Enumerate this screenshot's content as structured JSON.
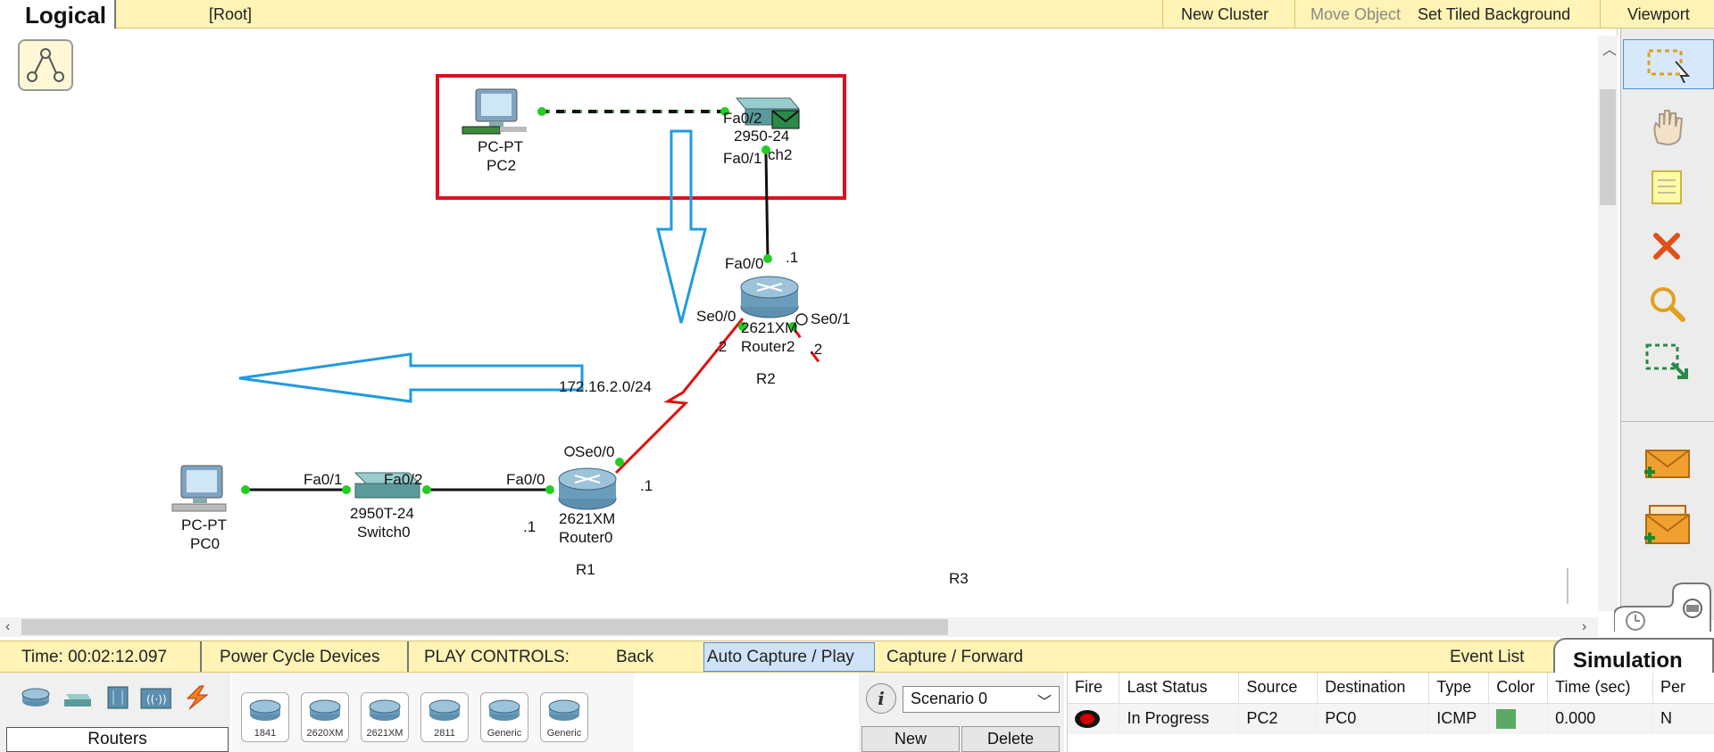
{
  "topbar": {
    "mode": "Logical",
    "path": "[Root]",
    "new_cluster": "New Cluster",
    "move_object": "Move Object",
    "set_tiled_background": "Set Tiled Background",
    "viewport": "Viewport"
  },
  "canvas": {
    "pc2": {
      "type": "PC-PT",
      "name": "PC2"
    },
    "switch2": {
      "port_top": "Fa0/2",
      "type": "2950-24",
      "name": "ch2",
      "port_bottom": "Fa0/1"
    },
    "router2": {
      "port_top": "Fa0/0",
      "addr_top": ".1",
      "port_left": "Se0/0",
      "port_right": "Se0/1",
      "type": "2621XM",
      "name": "Router2",
      "addr_left": ".2",
      "addr_right": ".2",
      "label": "R2"
    },
    "serial_net": "172.16.2.0/24",
    "router0": {
      "port_serial": "Se0/0",
      "addr_serial": ".1",
      "port_fa": "Fa0/0",
      "addr_fa": ".1",
      "type": "2621XM",
      "name": "Router0",
      "label": "R1"
    },
    "switch0": {
      "port_left": "Fa0/1",
      "port_right": "Fa0/2",
      "type": "2950T-24",
      "name": "Switch0"
    },
    "pc0": {
      "type": "PC-PT",
      "name": "PC0"
    },
    "r3_label": "R3"
  },
  "bottombar": {
    "time": "Time: 00:02:12.097",
    "power_cycle": "Power Cycle Devices",
    "play_controls": "PLAY CONTROLS:",
    "back": "Back",
    "auto_capture": "Auto Capture / Play",
    "capture_forward": "Capture / Forward",
    "event_list": "Event List",
    "simulation": "Simulation"
  },
  "palette": {
    "category_label": "Routers",
    "devices": [
      "1841",
      "2620XM",
      "2621XM",
      "2811",
      "Generic",
      "Generic"
    ]
  },
  "scenario": {
    "selected": "Scenario 0",
    "new": "New",
    "delete": "Delete"
  },
  "event_table": {
    "headers": [
      "Fire",
      "Last Status",
      "Source",
      "Destination",
      "Type",
      "Color",
      "Time (sec)",
      "Per"
    ],
    "rows": [
      {
        "last_status": "In Progress",
        "source": "PC2",
        "destination": "PC0",
        "type": "ICMP",
        "color": "#5aaa64",
        "time": "0.000",
        "per": "N"
      }
    ]
  },
  "colors": {
    "link_serial": "#e01010",
    "highlight_box": "#e01020",
    "arrow": "#1f9be0",
    "port_up": "#22cc22",
    "bar_bg": "#fff3b5"
  }
}
